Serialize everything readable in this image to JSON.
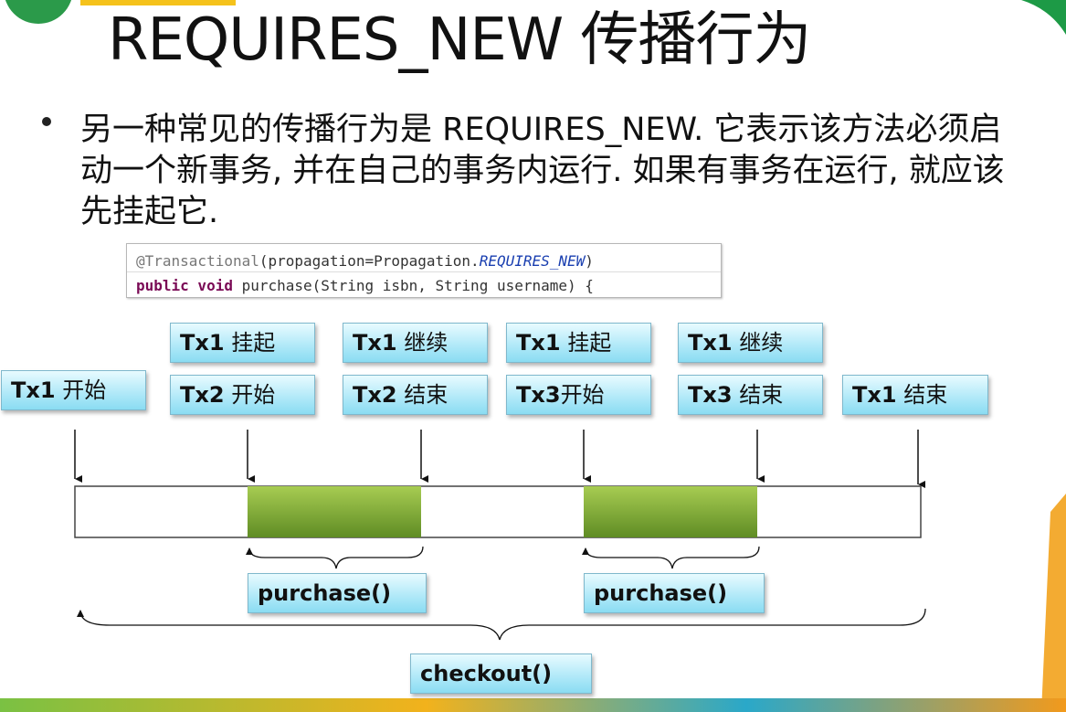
{
  "title": "REQUIRES_NEW 传播行为",
  "bullet": "另一种常见的传播行为是 REQUIRES_NEW. 它表示该方法必须启动一个新事务, 并在自己的事务内运行. 如果有事务在运行, 就应该先挂起它.",
  "code": {
    "line1_annotation": "@Transactional",
    "line1_rest": "(propagation=Propagation.",
    "line1_const": "REQUIRES_NEW",
    "line1_end": ")",
    "line2_kw": "public void",
    "line2_rest": " purchase(String isbn, String username) {"
  },
  "labels": {
    "tx1_start": "Tx1 开始",
    "tx1_suspend_1": "Tx1 挂起",
    "tx2_start": "Tx2 开始",
    "tx1_resume_1": "Tx1 继续",
    "tx2_end": "Tx2 结束",
    "tx1_suspend_2": "Tx1 挂起",
    "tx3_start": "Tx3开始",
    "tx1_resume_2": "Tx1 继续",
    "tx3_end": "Tx3 结束",
    "tx1_end": "Tx1 结束"
  },
  "methods": {
    "purchase_1": "purchase()",
    "purchase_2": "purchase()",
    "checkout": "checkout()"
  },
  "colors": {
    "label_fill": "#aee8f8",
    "inner_tx_fill": "#8db83f"
  }
}
